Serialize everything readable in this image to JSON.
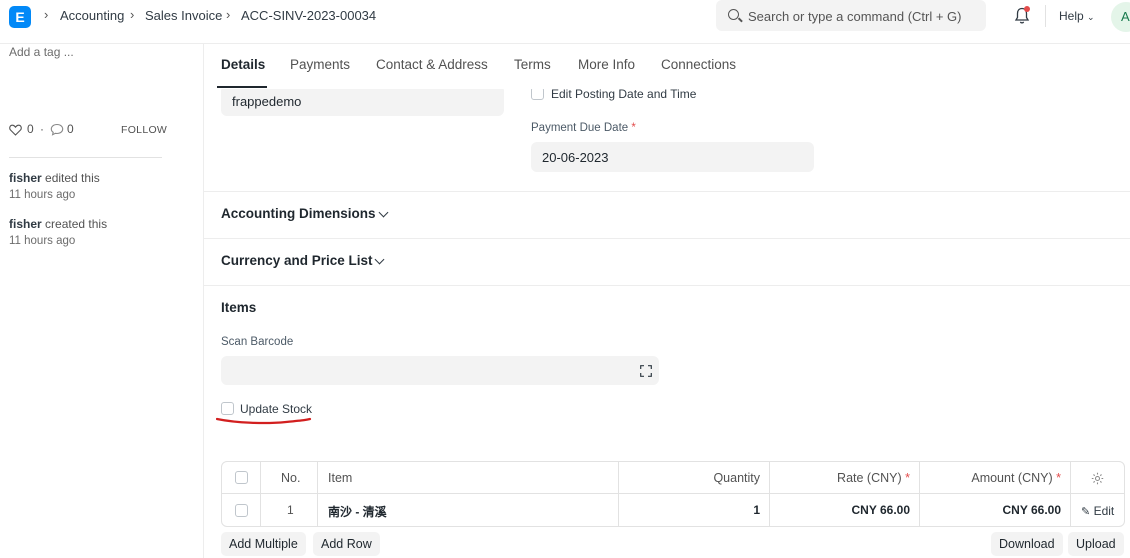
{
  "navbar": {
    "logo_letter": "E",
    "breadcrumbs": [
      "Accounting",
      "Sales Invoice",
      "ACC-SINV-2023-00034"
    ],
    "search_placeholder": "Search or type a command (Ctrl + G)",
    "help_label": "Help",
    "avatar_letter": "A"
  },
  "sidebar": {
    "add_tag": "Add a tag ...",
    "likes": "0",
    "comments": "0",
    "follow": "FOLLOW",
    "activity": [
      {
        "user": "fisher",
        "action": "edited this",
        "time": "11 hours ago"
      },
      {
        "user": "fisher",
        "action": "created this",
        "time": "11 hours ago"
      }
    ]
  },
  "tabs": [
    "Details",
    "Payments",
    "Contact & Address",
    "Terms",
    "More Info",
    "Connections"
  ],
  "form": {
    "company_value": "frappedemo",
    "edit_posting_label": "Edit Posting Date and Time",
    "payment_due_label": "Payment Due Date",
    "payment_due_value": "20-06-2023",
    "sections": [
      "Accounting Dimensions",
      "Currency and Price List"
    ],
    "items_title": "Items",
    "scan_barcode_label": "Scan Barcode",
    "update_stock_label": "Update Stock"
  },
  "items_table": {
    "headers": {
      "no": "No.",
      "item": "Item",
      "qty": "Quantity",
      "rate": "Rate (CNY)",
      "amount": "Amount (CNY)"
    },
    "rows": [
      {
        "no": "1",
        "item": "南沙 - 清溪",
        "qty": "1",
        "rate": "CNY 66.00",
        "amount": "CNY 66.00",
        "edit": "Edit"
      }
    ]
  },
  "actions": {
    "add_multiple": "Add Multiple",
    "add_row": "Add Row",
    "download": "Download",
    "upload": "Upload"
  },
  "colors": {
    "accent": "#0289f7",
    "required": "#e24c4c",
    "annotation": "#d21f1f"
  }
}
